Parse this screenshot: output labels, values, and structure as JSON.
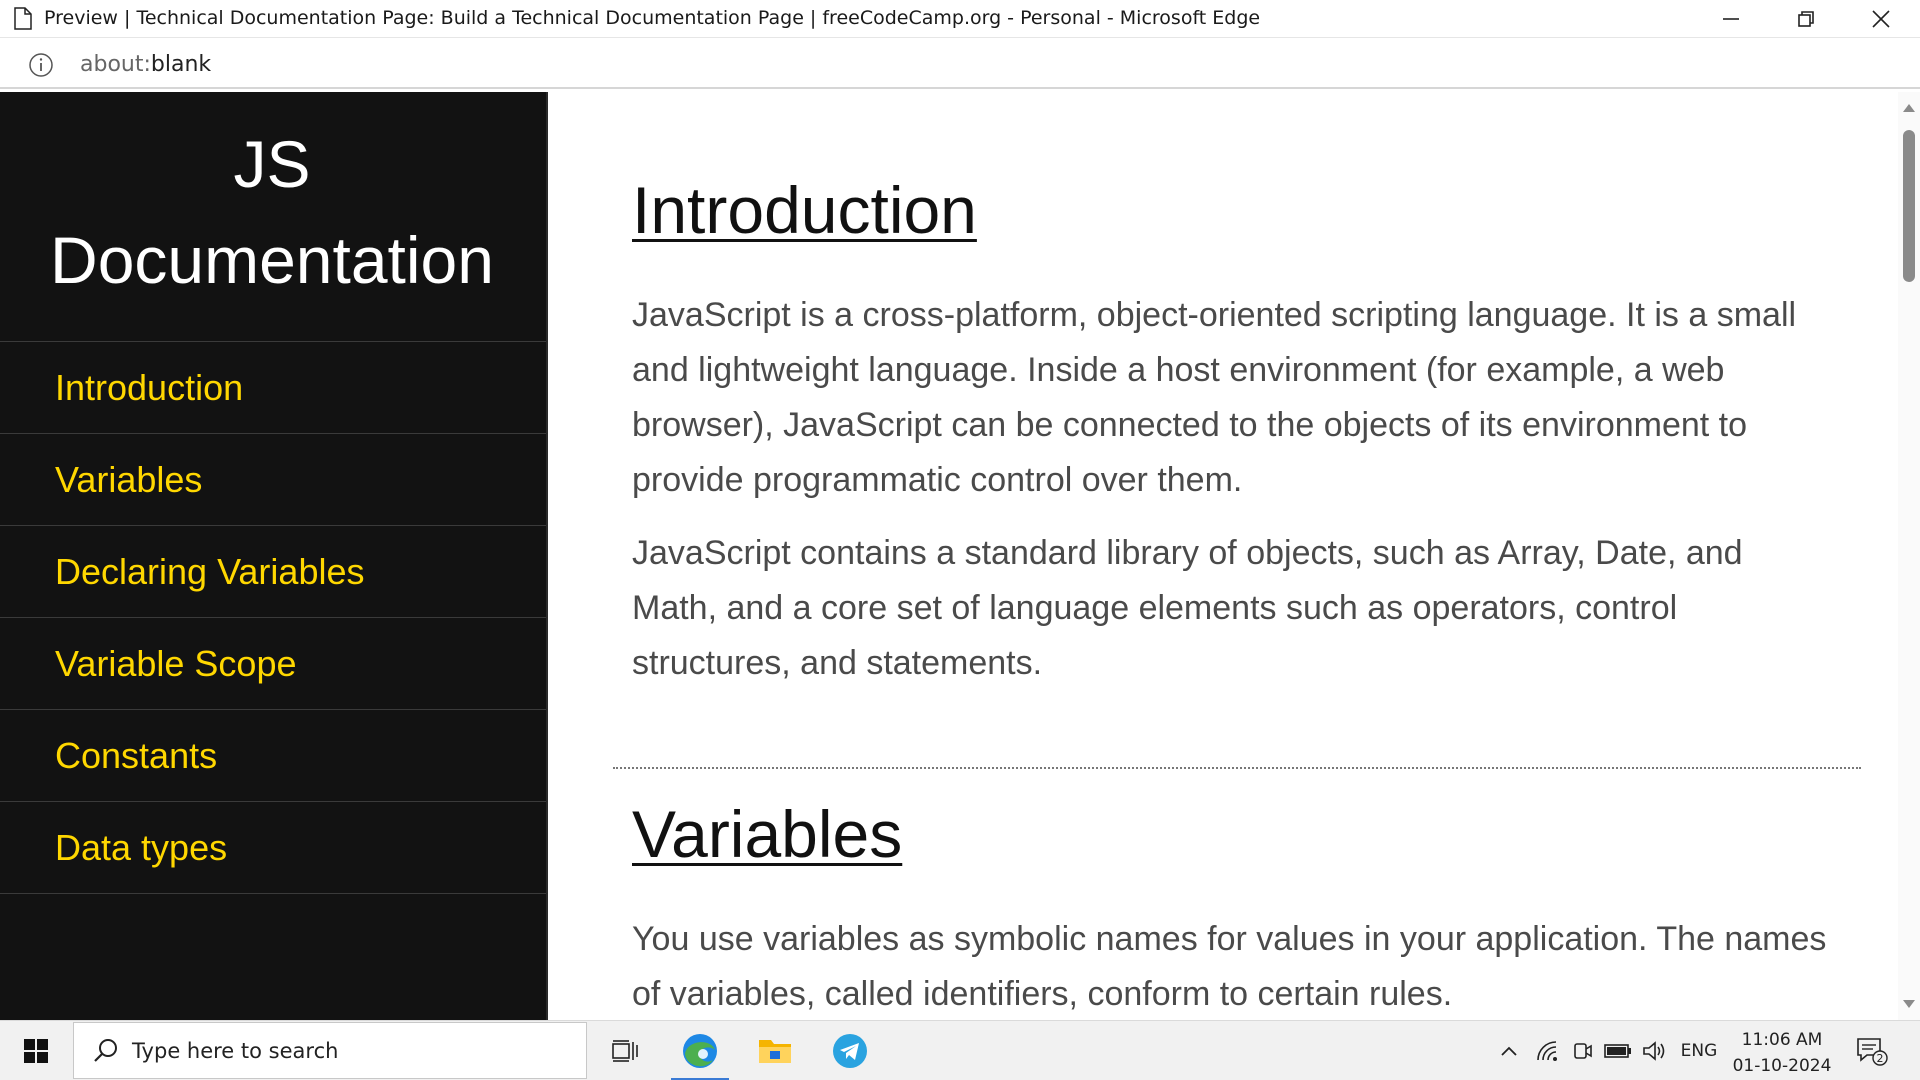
{
  "window": {
    "title": "Preview | Technical Documentation Page: Build a Technical Documentation Page | freeCodeCamp.org - Personal - Microsoft Edge"
  },
  "address_bar": {
    "url_scheme": "about:",
    "url_path": "blank"
  },
  "sidebar": {
    "heading_line1": "JS",
    "heading_line2": "Documentation",
    "items": [
      {
        "label": "Introduction"
      },
      {
        "label": "Variables"
      },
      {
        "label": "Declaring Variables"
      },
      {
        "label": "Variable Scope"
      },
      {
        "label": "Constants"
      },
      {
        "label": "Data types"
      }
    ]
  },
  "main": {
    "sections": [
      {
        "title": "Introduction",
        "paragraphs": [
          "JavaScript is a cross-platform, object-oriented scripting language. It is a small and lightweight language. Inside a host environment (for example, a web browser), JavaScript can be connected to the objects of its environment to provide programmatic control over them.",
          "JavaScript contains a standard library of objects, such as Array, Date, and Math, and a core set of language elements such as operators, control structures, and statements."
        ]
      },
      {
        "title": "Variables",
        "paragraphs": [
          "You use variables as symbolic names for values in your application. The names of variables, called identifiers, conform to certain rules."
        ]
      }
    ]
  },
  "taskbar": {
    "search_placeholder": "Type here to search",
    "language": "ENG",
    "time": "11:06 AM",
    "date": "01-10-2024",
    "notification_count": "2"
  },
  "colors": {
    "sidebar_bg": "#121212",
    "nav_link": "#ffd700",
    "body_text": "#4a4a4a"
  }
}
